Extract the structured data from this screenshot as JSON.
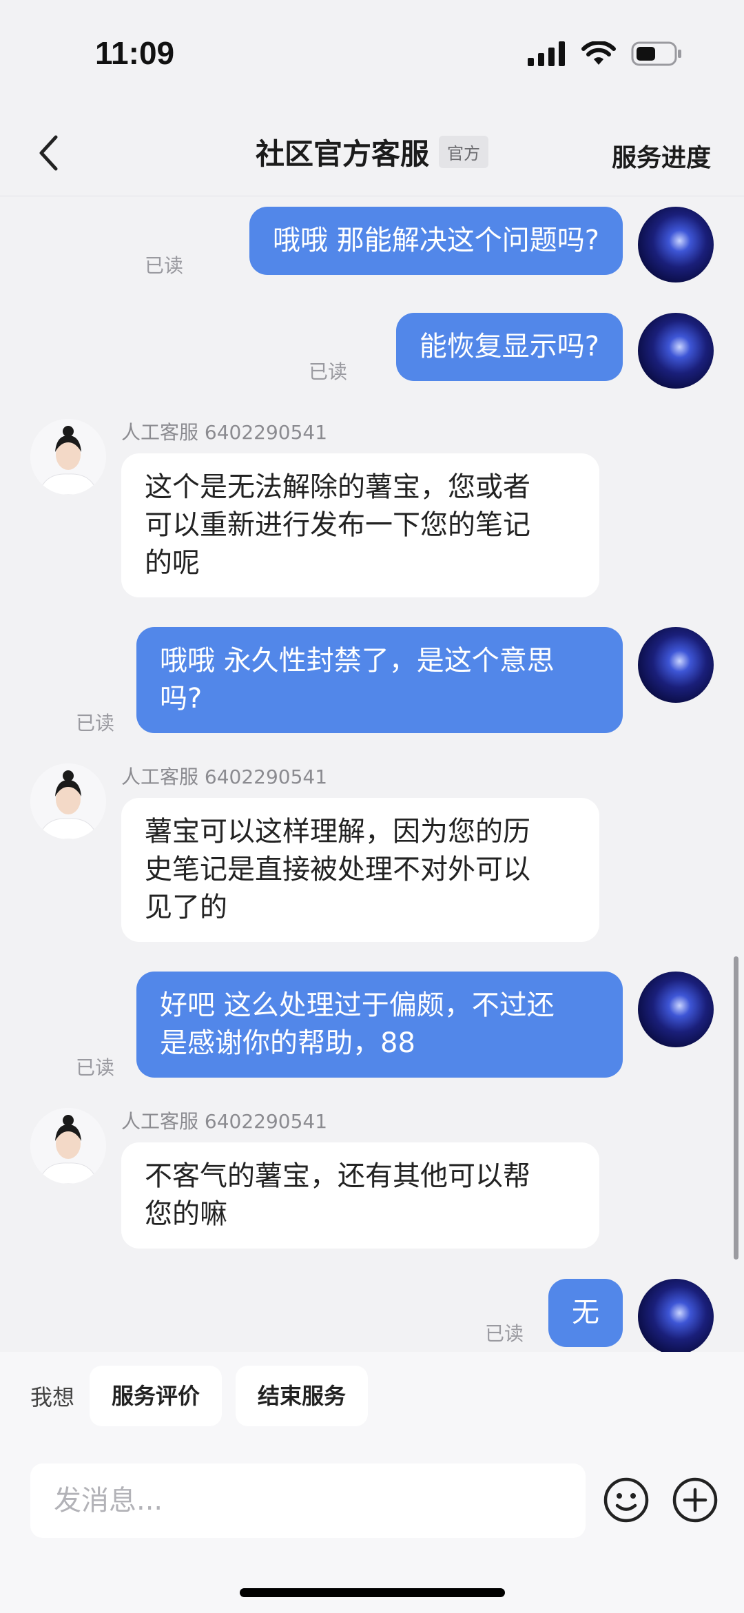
{
  "status_bar": {
    "time": "11:09",
    "icons": [
      "signal-icon",
      "wifi-icon",
      "battery-icon"
    ],
    "battery_level": 0.5
  },
  "header": {
    "back_icon": "chevron-left-icon",
    "title": "社区官方客服",
    "badge": "官方",
    "right_link": "服务进度"
  },
  "messages": [
    {
      "from": "me",
      "text": "哦哦 那能解决这个问题吗?",
      "read": "已读"
    },
    {
      "from": "me",
      "text": "能恢复显示吗?",
      "read": "已读"
    },
    {
      "from": "agent",
      "name": "人工客服 6402290541",
      "lines": [
        "这个是无法解除的薯宝，您或者",
        "可以重新进行发布一下您的笔记",
        "的呢"
      ]
    },
    {
      "from": "me",
      "lines": [
        "哦哦 永久性封禁了，是这个意思",
        "吗?"
      ],
      "read": "已读"
    },
    {
      "from": "agent",
      "name": "人工客服 6402290541",
      "lines": [
        "薯宝可以这样理解，因为您的历",
        "史笔记是直接被处理不对外可以",
        "见了的"
      ]
    },
    {
      "from": "me",
      "lines": [
        "好吧 这么处理过于偏颇，不过还",
        "是感谢你的帮助，88"
      ],
      "read": "已读"
    },
    {
      "from": "agent",
      "name": "人工客服 6402290541",
      "lines": [
        "不客气的薯宝，还有其他可以帮",
        "您的嘛"
      ]
    },
    {
      "from": "me",
      "text": "无",
      "read": "已读"
    }
  ],
  "bottom": {
    "quick_label": "我想",
    "quick_actions": [
      "服务评价",
      "结束服务"
    ],
    "input_placeholder": "发消息...",
    "emoji_icon": "emoji-icon",
    "plus_icon": "plus-icon"
  },
  "colors": {
    "my_bubble": "#5287e9",
    "agent_bubble": "#ffffff",
    "background": "#f2f2f4"
  }
}
